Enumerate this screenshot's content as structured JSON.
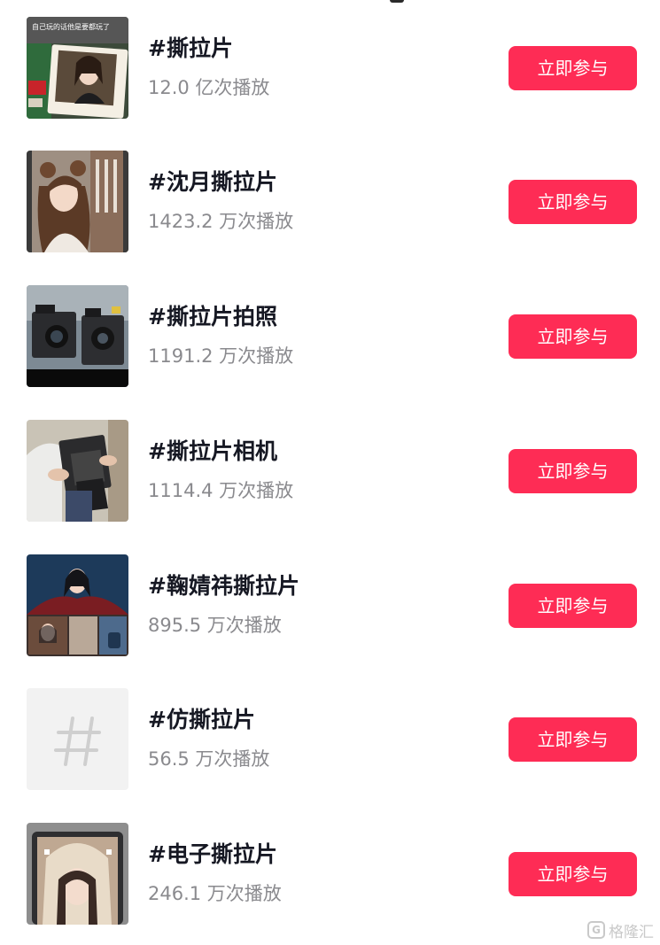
{
  "topics": [
    {
      "title": "#撕拉片",
      "plays": "12.0 亿次播放",
      "button": "立即参与",
      "thumb_caption": "自己玩的话他是要都玩了",
      "thumb_icon": "photo-thumb"
    },
    {
      "title": "#沈月撕拉片",
      "plays": "1423.2 万次播放",
      "button": "立即参与",
      "thumb_icon": "photo-thumb"
    },
    {
      "title": "#撕拉片拍照",
      "plays": "1191.2 万次播放",
      "button": "立即参与",
      "thumb_icon": "photo-thumb"
    },
    {
      "title": "#撕拉片相机",
      "plays": "1114.4 万次播放",
      "button": "立即参与",
      "thumb_icon": "photo-thumb"
    },
    {
      "title": "#鞠婧祎撕拉片",
      "plays": "895.5 万次播放",
      "button": "立即参与",
      "thumb_icon": "photo-thumb"
    },
    {
      "title": "#仿撕拉片",
      "plays": "56.5 万次播放",
      "button": "立即参与",
      "thumb_icon": "hashtag-icon"
    },
    {
      "title": "#电子撕拉片",
      "plays": "246.1 万次播放",
      "button": "立即参与",
      "thumb_icon": "photo-thumb"
    }
  ],
  "watermark": {
    "text": "格隆汇",
    "icon": "gelonghui-logo"
  },
  "colors": {
    "accent": "#fe2c55",
    "title": "#161823",
    "secondary_text": "#8a8a8e"
  }
}
